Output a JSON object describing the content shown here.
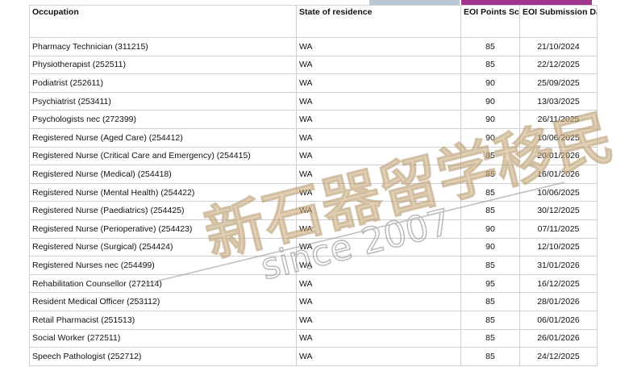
{
  "headers": {
    "occupation": "Occupation",
    "state": "State of residence",
    "score": "EOI Points Score",
    "date": "EOI Submission Date"
  },
  "rows": [
    {
      "occupation": "Pharmacy Technician (311215)",
      "state": "WA",
      "score": "85",
      "date": "21/10/2024"
    },
    {
      "occupation": "Physiotherapist (252511)",
      "state": "WA",
      "score": "85",
      "date": "22/12/2025"
    },
    {
      "occupation": "Podiatrist (252611)",
      "state": "WA",
      "score": "90",
      "date": "25/09/2025"
    },
    {
      "occupation": "Psychiatrist (253411)",
      "state": "WA",
      "score": "90",
      "date": "13/03/2025"
    },
    {
      "occupation": "Psychologists nec (272399)",
      "state": "WA",
      "score": "90",
      "date": "26/11/2025"
    },
    {
      "occupation": "Registered Nurse (Aged Care) (254412)",
      "state": "WA",
      "score": "90",
      "date": "10/06/2025"
    },
    {
      "occupation": "Registered Nurse (Critical Care and Emergency) (254415)",
      "state": "WA",
      "score": "85",
      "date": "20/01/2026"
    },
    {
      "occupation": "Registered Nurse (Medical) (254418)",
      "state": "WA",
      "score": "85",
      "date": "16/01/2026"
    },
    {
      "occupation": "Registered Nurse (Mental Health) (254422)",
      "state": "WA",
      "score": "85",
      "date": "10/06/2025"
    },
    {
      "occupation": "Registered Nurse (Paediatrics) (254425)",
      "state": "WA",
      "score": "85",
      "date": "30/12/2025"
    },
    {
      "occupation": "Registered Nurse (Perioperative) (254423)",
      "state": "WA",
      "score": "90",
      "date": "07/11/2025"
    },
    {
      "occupation": "Registered Nurse (Surgical) (254424)",
      "state": "WA",
      "score": "90",
      "date": "12/10/2025"
    },
    {
      "occupation": "Registered Nurses nec (254499)",
      "state": "WA",
      "score": "85",
      "date": "31/01/2026"
    },
    {
      "occupation": "Rehabilitation Counsellor (272114)",
      "state": "WA",
      "score": "95",
      "date": "16/12/2025"
    },
    {
      "occupation": "Resident Medical Officer (253112)",
      "state": "WA",
      "score": "85",
      "date": "28/01/2026"
    },
    {
      "occupation": "Retail Pharmacist (251513)",
      "state": "WA",
      "score": "85",
      "date": "06/01/2026"
    },
    {
      "occupation": "Social Worker (272511)",
      "state": "WA",
      "score": "85",
      "date": "26/01/2026"
    },
    {
      "occupation": "Speech Pathologist (252712)",
      "state": "WA",
      "score": "85",
      "date": "24/12/2025"
    }
  ],
  "watermark": {
    "brand_text": "新石器留学移民",
    "since_text": "since 2007",
    "color": "#d8b88a"
  },
  "colors": {
    "tab_blue": "#b7c7d6",
    "tab_purple": "#a2338f",
    "border": "#cfcfcf"
  }
}
